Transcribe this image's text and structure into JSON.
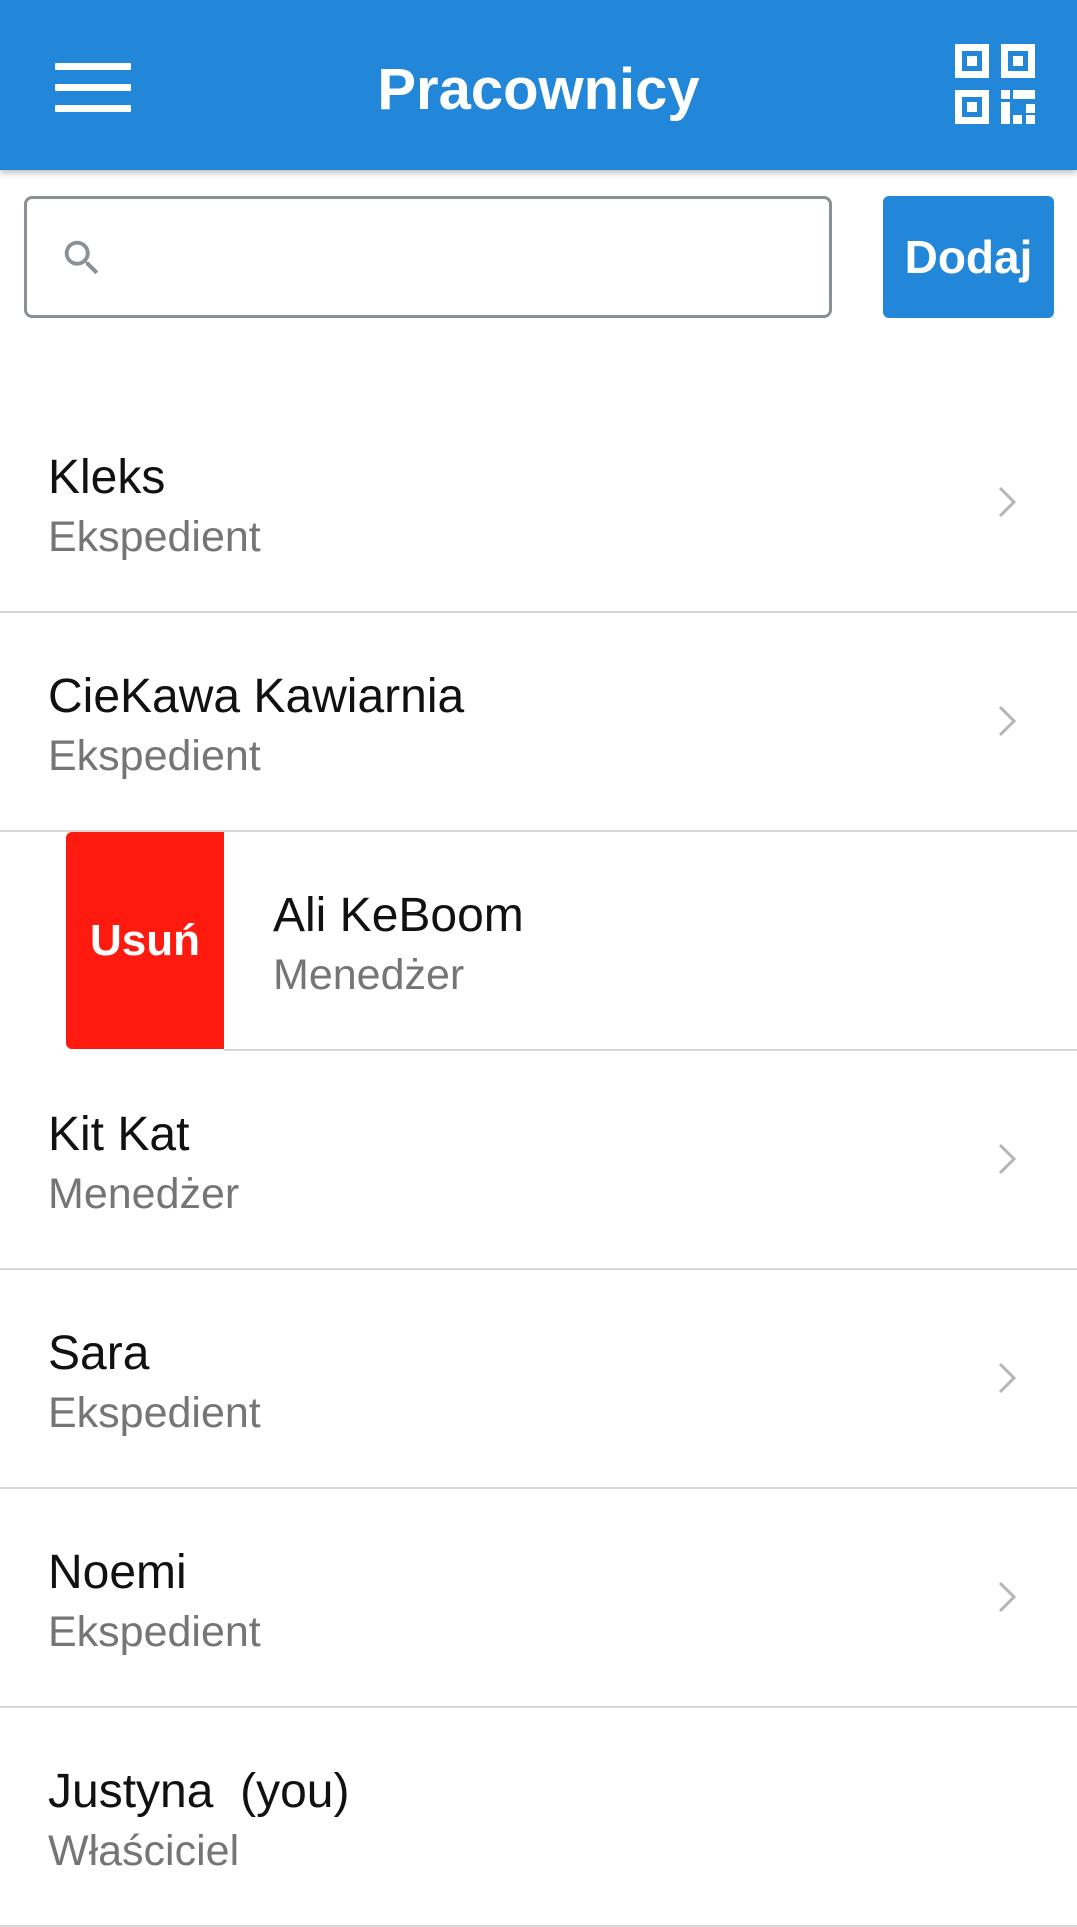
{
  "header": {
    "title": "Pracownicy",
    "background_color": "#2387d9",
    "menu_icon": "hamburger-menu-icon",
    "qr_icon": "qr-code-icon"
  },
  "search": {
    "value": "",
    "placeholder": "",
    "icon": "search-icon"
  },
  "add_button": {
    "label": "Dodaj"
  },
  "employees": [
    {
      "name": "Kleks",
      "role": "Ekspedient"
    },
    {
      "name": "CieKawa Kawiarnia",
      "role": "Ekspedient"
    },
    {
      "name": "Ali KeBoom",
      "role": "Menedżer",
      "delete_label": "Usuń"
    },
    {
      "name": "Kit Kat",
      "role": "Menedżer"
    },
    {
      "name": "Sara",
      "role": "Ekspedient"
    },
    {
      "name": "Noemi",
      "role": "Ekspedient"
    },
    {
      "name": "Justyna  (you)",
      "role": "Właściciel"
    }
  ],
  "colors": {
    "accent": "#2387d9",
    "delete": "#ff1a10",
    "secondary_text": "#757575"
  }
}
